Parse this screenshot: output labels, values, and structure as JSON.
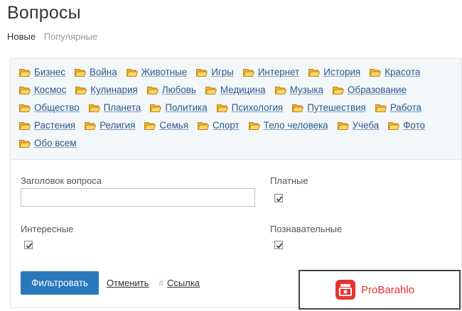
{
  "page": {
    "title": "Вопросы"
  },
  "tabs": [
    {
      "label": "Новые",
      "active": true
    },
    {
      "label": "Популярные",
      "active": false
    }
  ],
  "categories": [
    [
      "Бизнес",
      "Война",
      "Животные",
      "Игры",
      "Интернет",
      "История",
      "Красота"
    ],
    [
      "Космос",
      "Кулинария",
      "Любовь",
      "Медицина",
      "Музыка",
      "Образование"
    ],
    [
      "Общество",
      "Планета",
      "Политика",
      "Психология",
      "Путешествия",
      "Работа"
    ],
    [
      "Растения",
      "Религия",
      "Семья",
      "Спорт",
      "Тело человека",
      "Учеба",
      "Фото"
    ],
    [
      "Обо всем"
    ]
  ],
  "form": {
    "title_label": "Заголовок вопроса",
    "title_value": "",
    "paid_label": "Платные",
    "paid_checked": true,
    "interesting_label": "Интересные",
    "interesting_checked": true,
    "educational_label": "Познавательные",
    "educational_checked": true
  },
  "actions": {
    "filter_label": "Фильтровать",
    "cancel_label": "Отменить",
    "link_label": "Ссылка",
    "hash": "#"
  },
  "watermark": {
    "text": "ProBarahlo"
  },
  "colors": {
    "link": "#2a5a8c",
    "button": "#2a78bc",
    "folder": "#f0b432",
    "category_bg": "#f4f7f9",
    "watermark": "#e8332f"
  }
}
